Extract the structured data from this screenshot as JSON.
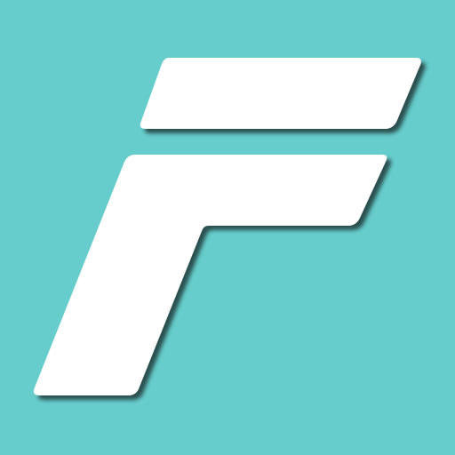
{
  "icon": {
    "name": "letter-f-logo-icon",
    "background_color": "#67CDCC",
    "glyph_color": "#FFFFFF",
    "shadow_color": "#1E3A3A"
  }
}
